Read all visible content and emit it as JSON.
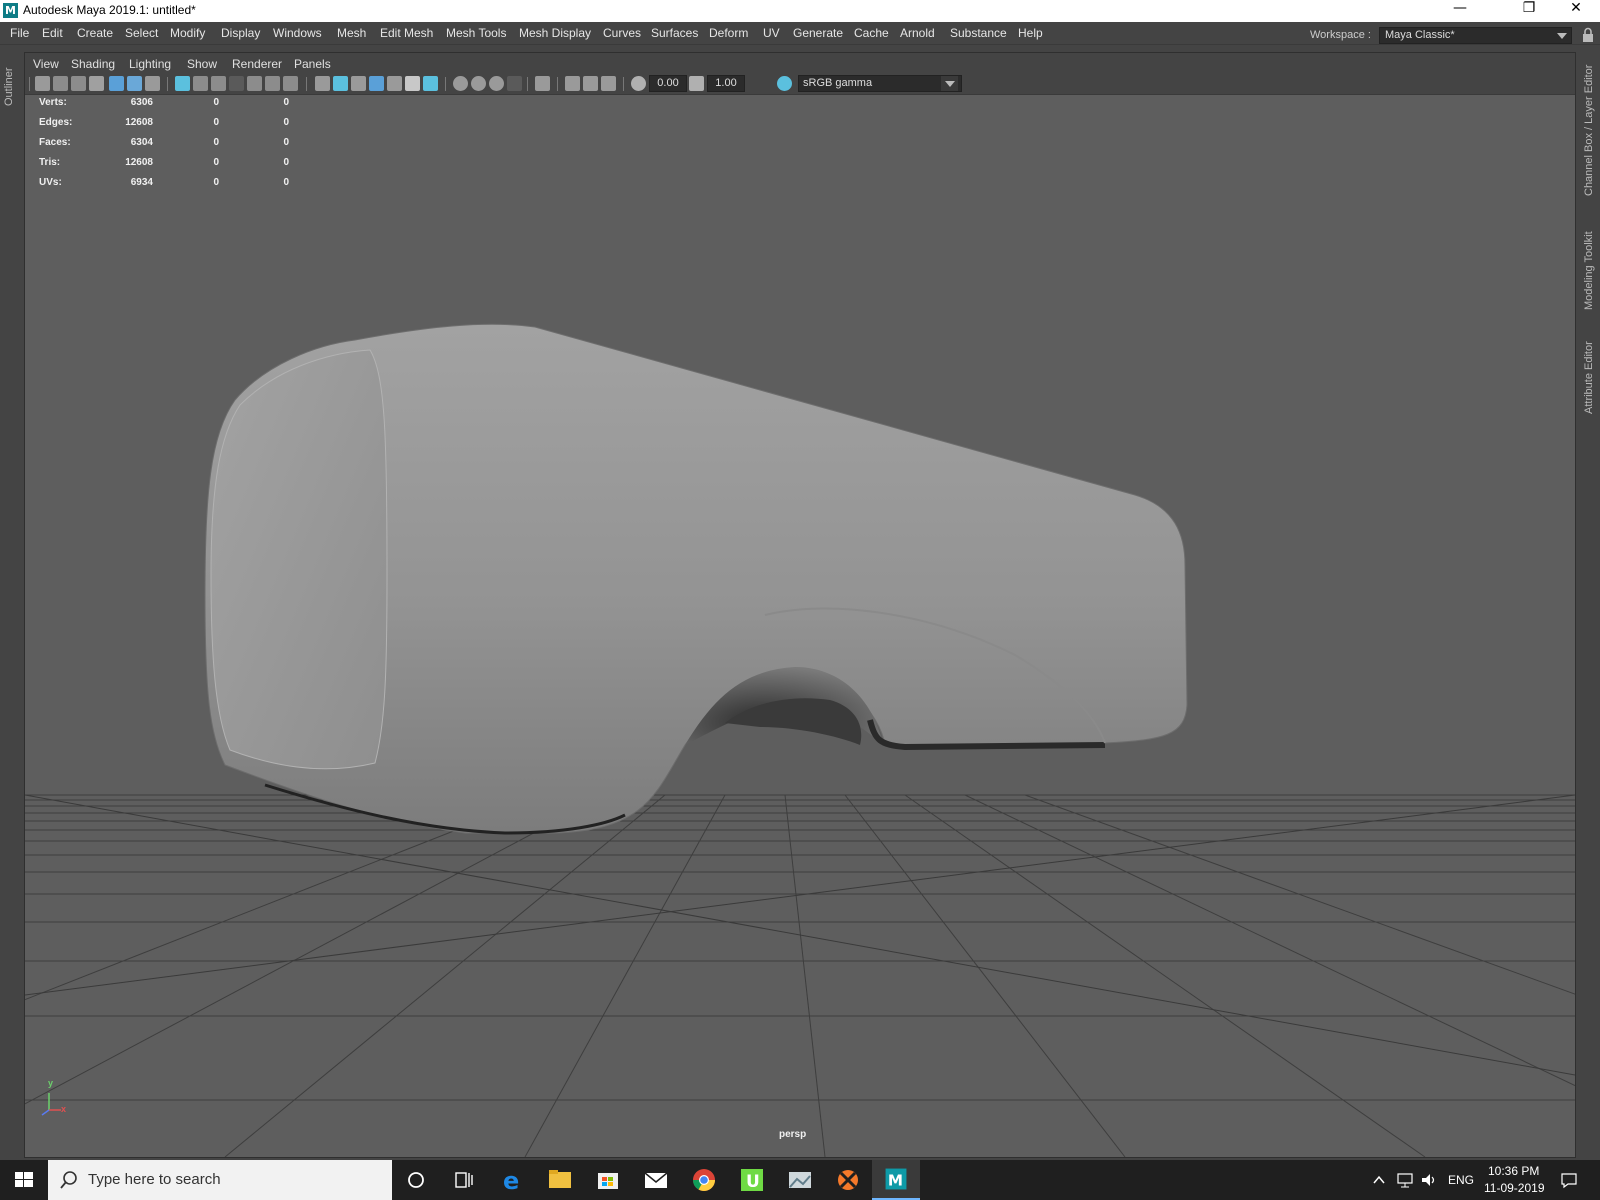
{
  "window": {
    "title": "Autodesk Maya 2019.1: untitled*",
    "app_icon_letter": "M"
  },
  "menubar": [
    "File",
    "Edit",
    "Create",
    "Select",
    "Modify",
    "Display",
    "Windows",
    "Mesh",
    "Edit Mesh",
    "Mesh Tools",
    "Mesh Display",
    "Curves",
    "Surfaces",
    "Deform",
    "UV",
    "Generate",
    "Cache",
    "Arnold",
    "Substance",
    "Help"
  ],
  "workspace": {
    "label": "Workspace :",
    "value": "Maya Classic*"
  },
  "side_tabs": {
    "left": "Outliner",
    "right": [
      "Channel Box / Layer Editor",
      "Modeling Toolkit",
      "Attribute Editor"
    ]
  },
  "panel_menu": [
    "View",
    "Shading",
    "Lighting",
    "Show",
    "Renderer",
    "Panels"
  ],
  "panel_toolbar": {
    "exposure": "0.00",
    "gamma": "1.00",
    "color_space": "sRGB gamma"
  },
  "hud": [
    {
      "label": "Verts:",
      "v1": "6306",
      "v2": "0",
      "v3": "0"
    },
    {
      "label": "Edges:",
      "v1": "12608",
      "v2": "0",
      "v3": "0"
    },
    {
      "label": "Faces:",
      "v1": "6304",
      "v2": "0",
      "v3": "0"
    },
    {
      "label": "Tris:",
      "v1": "12608",
      "v2": "0",
      "v3": "0"
    },
    {
      "label": "UVs:",
      "v1": "6934",
      "v2": "0",
      "v3": "0"
    }
  ],
  "camera": "persp",
  "axis": {
    "y": "y",
    "x": "x"
  },
  "taskbar": {
    "search_placeholder": "Type here to search",
    "language": "ENG",
    "time": "10:36 PM",
    "date": "11-09-2019"
  },
  "colors": {
    "viewport_bg": "#5e5e5e",
    "ui_bg": "#444444",
    "accent_active": "#5bc0de",
    "taskbar_bg": "#1f1f1f"
  }
}
